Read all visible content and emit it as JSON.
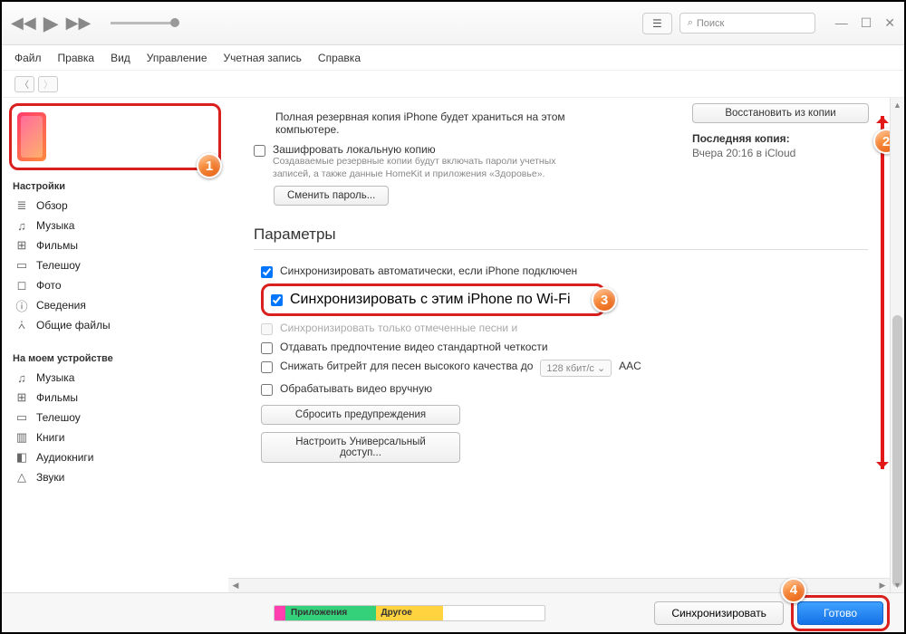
{
  "titlebar": {
    "search_placeholder": "Поиск"
  },
  "menubar": [
    "Файл",
    "Правка",
    "Вид",
    "Управление",
    "Учетная запись",
    "Справка"
  ],
  "sidebar": {
    "settings_header": "Настройки",
    "settings_items": [
      {
        "icon": "≣",
        "label": "Обзор"
      },
      {
        "icon": "♫",
        "label": "Музыка"
      },
      {
        "icon": "⊞",
        "label": "Фильмы"
      },
      {
        "icon": "▭",
        "label": "Телешоу"
      },
      {
        "icon": "◻",
        "label": "Фото"
      },
      {
        "icon": "ⓘ",
        "label": "Сведения"
      },
      {
        "icon": "⩑",
        "label": "Общие файлы"
      }
    ],
    "device_header": "На моем устройстве",
    "device_items": [
      {
        "icon": "♫",
        "label": "Музыка"
      },
      {
        "icon": "⊞",
        "label": "Фильмы"
      },
      {
        "icon": "▭",
        "label": "Телешоу"
      },
      {
        "icon": "▥",
        "label": "Книги"
      },
      {
        "icon": "◧",
        "label": "Аудиокниги"
      },
      {
        "icon": "△",
        "label": "Звуки"
      }
    ]
  },
  "backup": {
    "desc": "Полная резервная копия iPhone будет храниться на этом компьютере.",
    "encrypt_label": "Зашифровать локальную копию",
    "encrypt_note": "Создаваемые резервные копии будут включать пароли учетных записей, а также данные HomeKit и приложения «Здоровье».",
    "change_pw": "Сменить пароль...",
    "restore_btn": "Восстановить из копии",
    "last_label": "Последняя копия:",
    "last_value": "Вчера 20:16 в iCloud"
  },
  "options": {
    "title": "Параметры",
    "auto_sync": "Синхронизировать автоматически, если iPhone подключен",
    "wifi_sync": "Синхронизировать с этим iPhone по Wi-Fi",
    "only_checked": "Синхронизировать только отмеченные песни и",
    "prefer_sd": "Отдавать предпочтение видео стандартной четкости",
    "lower_bitrate": "Снижать битрейт для песен высокого качества до",
    "bitrate_value": "128 кбит/с",
    "bitrate_format": "AAC",
    "manual_video": "Обрабатывать видео вручную",
    "reset_warnings": "Сбросить предупреждения",
    "universal_access": "Настроить Универсальный доступ..."
  },
  "footer": {
    "apps": "Приложения",
    "other": "Другое",
    "sync": "Синхронизировать",
    "done": "Готово"
  },
  "badges": {
    "b1": "1",
    "b2": "2",
    "b3": "3",
    "b4": "4"
  },
  "colors": {
    "highlight": "#d9201e",
    "badge": "#e35a0f"
  }
}
